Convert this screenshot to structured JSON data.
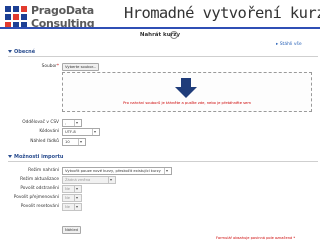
{
  "banner": {
    "logo_line1": "PragoData",
    "logo_line2": "Consulting",
    "title": "Hromadné vytvoření kurzů"
  },
  "page": {
    "title": "Nahrát kurzy",
    "expand_all": "Stáhli vše"
  },
  "section_general": {
    "heading": "Obecné",
    "file_label": "Soubor",
    "required_mark": "*",
    "choose_button": "Vyberte soubor...",
    "drop_text": "Pro nahrání souborů je táhněte a pusťte zde, nebo je přetáhněte sem",
    "delimiter_label": "Oddělovač v CSV",
    "delimiter_value": ",",
    "encoding_label": "Kódování",
    "encoding_value": "UTF-8",
    "preview_label": "Náhled řádků",
    "preview_value": "10"
  },
  "section_import": {
    "heading": "Možnosti importu",
    "mode_label": "Režim nahrání",
    "mode_value": "Vytvořit pouze nové kurzy, přeskočit existující kurzy",
    "update_label": "Režim aktualizace",
    "update_value": "Žádná změna",
    "allow_delete_label": "Povolit odstranění",
    "allow_delete_value": "Ne",
    "allow_rename_label": "Povolit přejmenování",
    "allow_rename_value": "Ne",
    "allow_reset_label": "Povolit resetování",
    "allow_reset_value": "Ne"
  },
  "footer": {
    "preview_button": "Náhled",
    "required_note": "Formulář obsahuje povinná pole označená",
    "required_mark": "*"
  },
  "colors": {
    "accent_blue": "#2f4fb5",
    "section_blue": "#2a4d8f",
    "link_blue": "#2a63b8",
    "required_red": "#cc0000"
  }
}
